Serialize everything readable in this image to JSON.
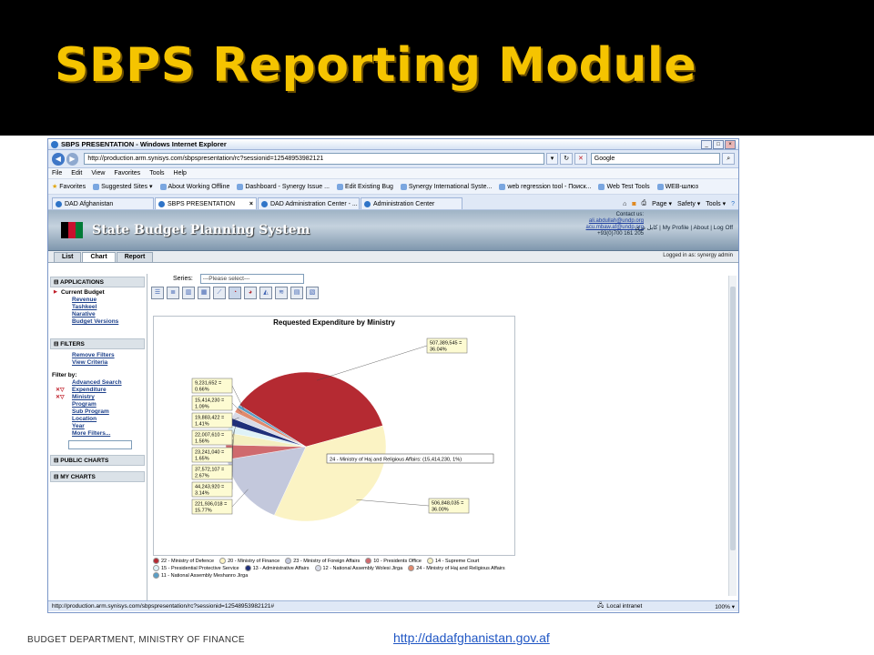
{
  "slide": {
    "title": "SBPS Reporting Module",
    "footer": "BUDGET DEPARTMENT,  MINISTRY OF FINANCE",
    "link": "http://dadafghanistan.gov.af"
  },
  "browser": {
    "window_title": "SBPS PRESENTATION - Windows Internet Explorer",
    "address": "http://production.arm.synisys.com/sbpspresentation/rc?sessionid=12548953982121",
    "search_placeholder": "Google",
    "menu": [
      "File",
      "Edit",
      "View",
      "Favorites",
      "Tools",
      "Help"
    ],
    "favorites_label": "Favorites",
    "favorites": [
      "Suggested Sites ▾",
      "About Working Offline",
      "Dashboard - Synergy Issue ...",
      "Edit Existing Bug",
      "Synergy International Syste...",
      "web regression tool - Поиск...",
      "Web Test Tools",
      "WEB-шлюз"
    ],
    "tabs": [
      {
        "label": "DAD Afghanistan",
        "active": false
      },
      {
        "label": "SBPS PRESENTATION",
        "active": true
      },
      {
        "label": "DAD Administration Center - ...",
        "active": false
      },
      {
        "label": "Administration Center",
        "active": false
      }
    ],
    "tab_tools": {
      "page": "Page ▾",
      "safety": "Safety ▾",
      "tools": "Tools ▾"
    },
    "status_url": "http://production.arm.synisys.com/sbpspresentation/rc?sessionid=12548953982121#",
    "status_zone": "Local intranet",
    "status_zoom": "100% ▾"
  },
  "app": {
    "system_title": "State Budget Planning System",
    "contact_label": "Contact us:",
    "contact_email1": "ali.abdullah@undp.org",
    "contact_email2": "acu.mbaw.af@undp.org",
    "contact_phone": "+93(0)700 161 205",
    "banner_links": "کابل دری  |  My Profile  |  About  |  Log Off",
    "tabs": [
      "List",
      "Chart",
      "Report"
    ],
    "logged_in": "Logged in as: synergy admin",
    "sidebar": {
      "applications_header": "APPLICATIONS",
      "current_budget": "Current Budget",
      "app_links": [
        "Revenue",
        "Tashkeel",
        "Narative",
        "Budget Versions"
      ],
      "filters_header": "FILTERS",
      "filter_links": [
        "Remove Filters",
        "View Criteria"
      ],
      "filter_by": "Filter by:",
      "filter_by_links": [
        "Advanced Search",
        "Expenditure",
        "Ministry",
        "Program",
        "Sub Program",
        "Location",
        "Year",
        "More Filters..."
      ],
      "public_charts": "PUBLIC CHARTS",
      "my_charts": "MY CHARTS"
    },
    "series_label": "Series:",
    "series_value": "---Please select---"
  },
  "chart_data": {
    "type": "pie",
    "title": "Requested Expenditure by Ministry",
    "slices": [
      {
        "label": "22 - Ministry of Defence",
        "value": 507389545,
        "percent": "36.04%",
        "color": "#b52a32"
      },
      {
        "label": "20 - Ministry of Finance",
        "value": 506848035,
        "percent": "36.00%",
        "color": "#fbf3c4"
      },
      {
        "label": "23 - Ministry of Foreign Affairs",
        "value": 221936018,
        "percent": "15.77%",
        "color": "#c3c8dc"
      },
      {
        "label": "10 - Presidents Office",
        "value": 44243920,
        "percent": "3.14%",
        "color": "#cf6a6e"
      },
      {
        "label": "14 - Supreme Court",
        "value": 37572107,
        "percent": "2.67%",
        "color": "#f4efc0"
      },
      {
        "label": "15 - Presidential Protective Service",
        "value": 23241040,
        "percent": "1.65%",
        "color": "#dff2f7"
      },
      {
        "label": "13 - Administrative Affairs",
        "value": 22007610,
        "percent": "1.56%",
        "color": "#1f2f7a"
      },
      {
        "label": "12 - National Assembly  Wolesi Jirga",
        "value": 19883422,
        "percent": "1.41%",
        "color": "#d8dbe8"
      },
      {
        "label": "24 - Ministry of Haj and Religious Affairs",
        "value": 15414230,
        "percent": "1.09%",
        "color": "#e08a6e"
      },
      {
        "label": "11 - National Assembly Meshanro Jirga",
        "value": 9231652,
        "percent": "0.66%",
        "color": "#5a9ec6"
      }
    ],
    "callouts": [
      {
        "text1": "507,389,545 =",
        "text2": "36.04%"
      },
      {
        "text1": "506,848,035 =",
        "text2": "36.00%"
      },
      {
        "text1": "221,936,018 =",
        "text2": "15.77%"
      },
      {
        "text1": "44,243,920 =",
        "text2": "3.14%"
      },
      {
        "text1": "37,572,107 =",
        "text2": "2.67%"
      },
      {
        "text1": "23,241,040 =",
        "text2": "1.65%"
      },
      {
        "text1": "22,007,610 =",
        "text2": "1.56%"
      },
      {
        "text1": "19,883,422 =",
        "text2": "1.41%"
      },
      {
        "text1": "15,414,230 =",
        "text2": "1.09%"
      },
      {
        "text1": "9,231,652 =",
        "text2": "0.66%"
      }
    ],
    "tooltip": "24 - Ministry of Haj and Religious Affairs: (15,414,230, 1%)"
  }
}
